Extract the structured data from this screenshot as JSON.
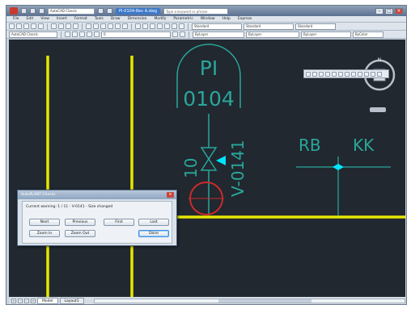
{
  "window": {
    "title_button": "AutoCAD Classic",
    "title": "PI-0104-Rev A.dwg",
    "search_placeholder": "Type a keyword or phrase"
  },
  "menu": [
    "File",
    "Edit",
    "View",
    "Insert",
    "Format",
    "Tools",
    "Draw",
    "Dimension",
    "Modify",
    "Parametric",
    "Window",
    "Help",
    "Express"
  ],
  "toolbar": {
    "workspace": "AutoCAD Classic",
    "layer": "0",
    "style_standard": "Standard",
    "dim_standard": "Standard",
    "table_standard": "Standard",
    "bylayer_color": "ByLayer",
    "bylayer_linetype": "ByLayer",
    "bylayer_lineweight": "ByLayer",
    "plot_style": "ByColor"
  },
  "drawing": {
    "instrument_tag_top": "PI",
    "instrument_tag_number": "0104",
    "valve_size": "10",
    "valve_tag": "V-0141",
    "label_rb": "RB",
    "label_kk": "KK"
  },
  "colors": {
    "canvas": "#212830",
    "pipe": "#e6e600",
    "instrument": "#2aa69a",
    "highlight_circle": "#cc2a2a",
    "flow_arrow": "#00e5ff"
  },
  "dialog": {
    "title": "AutoPLANT Checks",
    "status": "Current warning: 1 / 11 - V-0141 - Size changed",
    "buttons": {
      "next": "Next",
      "previous": "Previous",
      "first": "First",
      "last": "Last",
      "zoom_in": "Zoom In",
      "zoom_out": "Zoom Out",
      "done": "Done"
    }
  },
  "tabs": [
    "Model",
    "Layout1"
  ],
  "viewcube": {
    "compass": "N"
  }
}
